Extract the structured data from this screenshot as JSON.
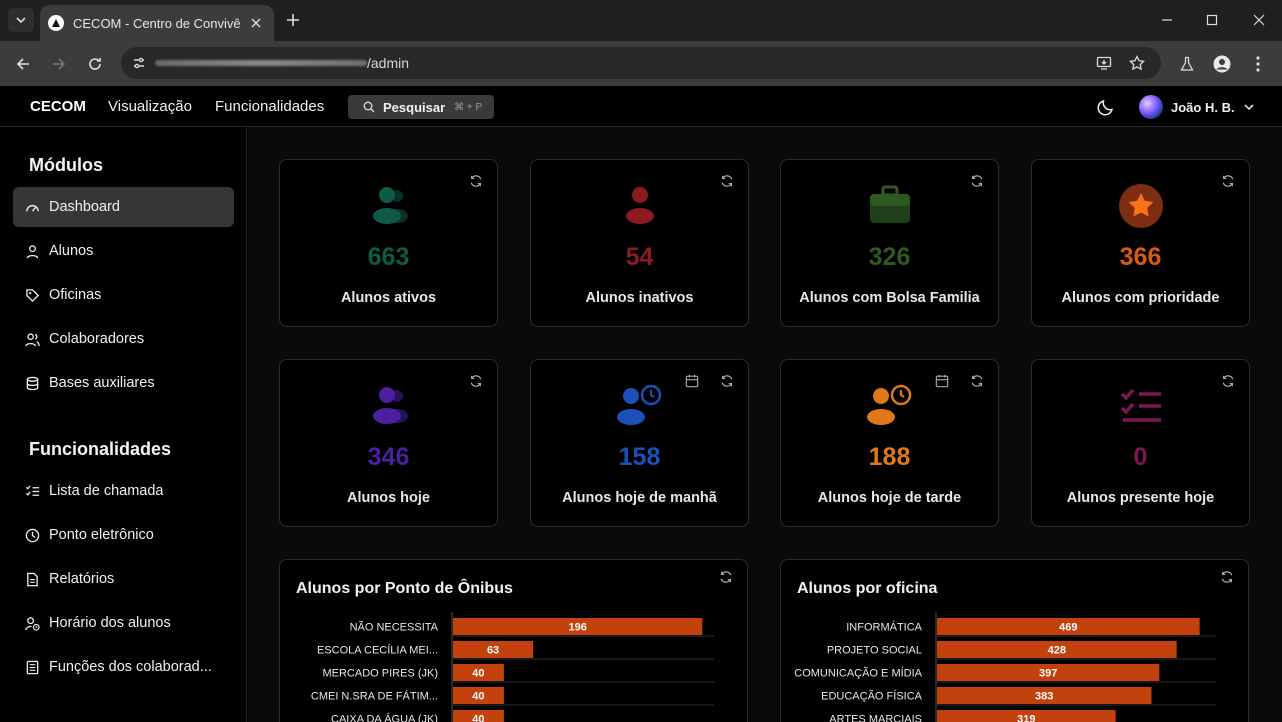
{
  "browser": {
    "tab_title": "CECOM - Centro de Convivência",
    "url_path": "/admin"
  },
  "header": {
    "brand": "CECOM",
    "nav": [
      "Visualização",
      "Funcionalidades"
    ],
    "search_label": "Pesquisar",
    "search_shortcut": "⌘ + P",
    "user_name": "João H. B."
  },
  "sidebar": {
    "modules_heading": "Módulos",
    "modules": [
      {
        "label": "Dashboard",
        "icon": "gauge-icon",
        "active": true
      },
      {
        "label": "Alunos",
        "icon": "user-icon"
      },
      {
        "label": "Oficinas",
        "icon": "tag-icon"
      },
      {
        "label": "Colaboradores",
        "icon": "users-icon"
      },
      {
        "label": "Bases auxiliares",
        "icon": "database-icon"
      }
    ],
    "features_heading": "Funcionalidades",
    "features": [
      {
        "label": "Lista de chamada",
        "icon": "checklist-icon"
      },
      {
        "label": "Ponto eletrônico",
        "icon": "clock-icon"
      },
      {
        "label": "Relatórios",
        "icon": "file-icon"
      },
      {
        "label": "Horário dos alunos",
        "icon": "user-clock-icon"
      },
      {
        "label": "Funções dos colaborad...",
        "icon": "file-list-icon"
      }
    ]
  },
  "cards": [
    {
      "value": "663",
      "label": "Alunos ativos",
      "icon": "users-icon",
      "color": "#0f5a47"
    },
    {
      "value": "54",
      "label": "Alunos inativos",
      "icon": "users-icon",
      "color": "#8b1a22"
    },
    {
      "value": "326",
      "label": "Alunos com Bolsa Familia",
      "icon": "briefcase-icon",
      "color": "#2e5a22"
    },
    {
      "value": "366",
      "label": "Alunos com prioridade",
      "icon": "star-icon",
      "color": "#d95a12"
    },
    {
      "value": "346",
      "label": "Alunos hoje",
      "icon": "users-icon",
      "color": "#4b1fa0"
    },
    {
      "value": "158",
      "label": "Alunos hoje de manhã",
      "icon": "user-clock-icon",
      "color": "#1d4fb8"
    },
    {
      "value": "188",
      "label": "Alunos hoje de tarde",
      "icon": "user-clock-icon",
      "color": "#e0771a"
    },
    {
      "value": "0",
      "label": "Alunos presente hoje",
      "icon": "checklist-icon",
      "color": "#7a1850"
    }
  ],
  "chart_data": [
    {
      "type": "bar",
      "title": "Alunos por Ponto de Ônibus",
      "categories": [
        "NÃO NECESSITA",
        "ESCOLA CECÍLIA MEI...",
        "MERCADO PIRES (JK)",
        "CMEI N.SRA DE FÁTIM...",
        "CAIXA DA ÁGUA (JK)"
      ],
      "values": [
        196,
        63,
        40,
        40,
        40
      ],
      "xlim": [
        0,
        206
      ],
      "bar_color": "#c2410c"
    },
    {
      "type": "bar",
      "title": "Alunos por oficina",
      "categories": [
        "INFORMÁTICA",
        "PROJETO SOCIAL",
        "COMUNICAÇÃO E MÍDIA",
        "EDUCAÇÃO FÍSICA",
        "ARTES MARCIAIS"
      ],
      "values": [
        469,
        428,
        397,
        383,
        319
      ],
      "xlim": [
        0,
        500
      ],
      "bar_color": "#c2410c"
    }
  ]
}
